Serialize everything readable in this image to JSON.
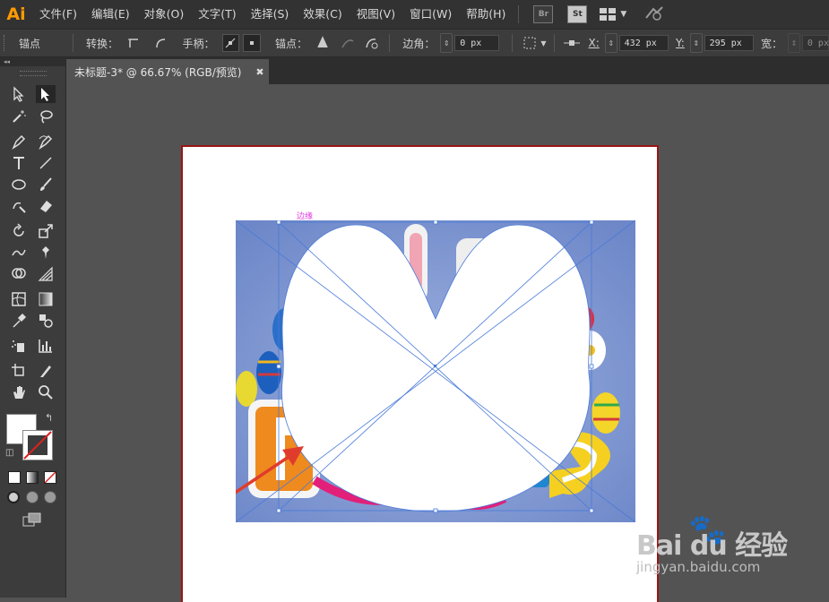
{
  "app": {
    "logo": "Ai"
  },
  "menu": {
    "items": [
      "文件(F)",
      "编辑(E)",
      "对象(O)",
      "文字(T)",
      "选择(S)",
      "效果(C)",
      "视图(V)",
      "窗口(W)",
      "帮助(H)"
    ],
    "bridge": "Br",
    "stock": "St"
  },
  "control": {
    "anchor_label": "锚点",
    "convert_label": "转换：",
    "handles_label": "手柄：",
    "anchor_points_label": "锚点：",
    "corner_label": "边角：",
    "corner_value": "0 px",
    "x_label": "X:",
    "x_value": "432 px",
    "y_label": "Y:",
    "y_value": "295 px",
    "width_label": "宽：",
    "width_value": "0 px"
  },
  "tools_panel": {
    "collapse": "◂◂"
  },
  "document": {
    "tab_title": "未标题-3* @ 66.67% (RGB/预览)",
    "close_glyph": "✖",
    "edge_label": "边缘"
  },
  "watermark": {
    "logo": "Bai du 经验",
    "url": "jingyan.baidu.com"
  },
  "colors": {
    "accent_logo": "#ff9a00",
    "artboard_border": "#9a1515",
    "selection": "#4a7ad8",
    "arrow": "#e03c2c",
    "photo_bg": "#7b94cf"
  },
  "icons": [
    "select-icon",
    "direct-select-icon",
    "magic-wand-icon",
    "lasso-icon",
    "pen-icon",
    "curvature-icon",
    "type-icon",
    "line-icon",
    "ellipse-icon",
    "paintbrush-icon",
    "shaper-icon",
    "eraser-icon",
    "rotate-icon",
    "scale-icon",
    "warp-icon",
    "pin-icon",
    "shape-builder-icon",
    "perspective-icon",
    "mesh-icon",
    "gradient-icon",
    "eyedropper-icon",
    "blend-icon",
    "symbol-sprayer-icon",
    "graph-icon",
    "artboard-icon",
    "slice-icon",
    "hand-icon",
    "zoom-icon"
  ]
}
